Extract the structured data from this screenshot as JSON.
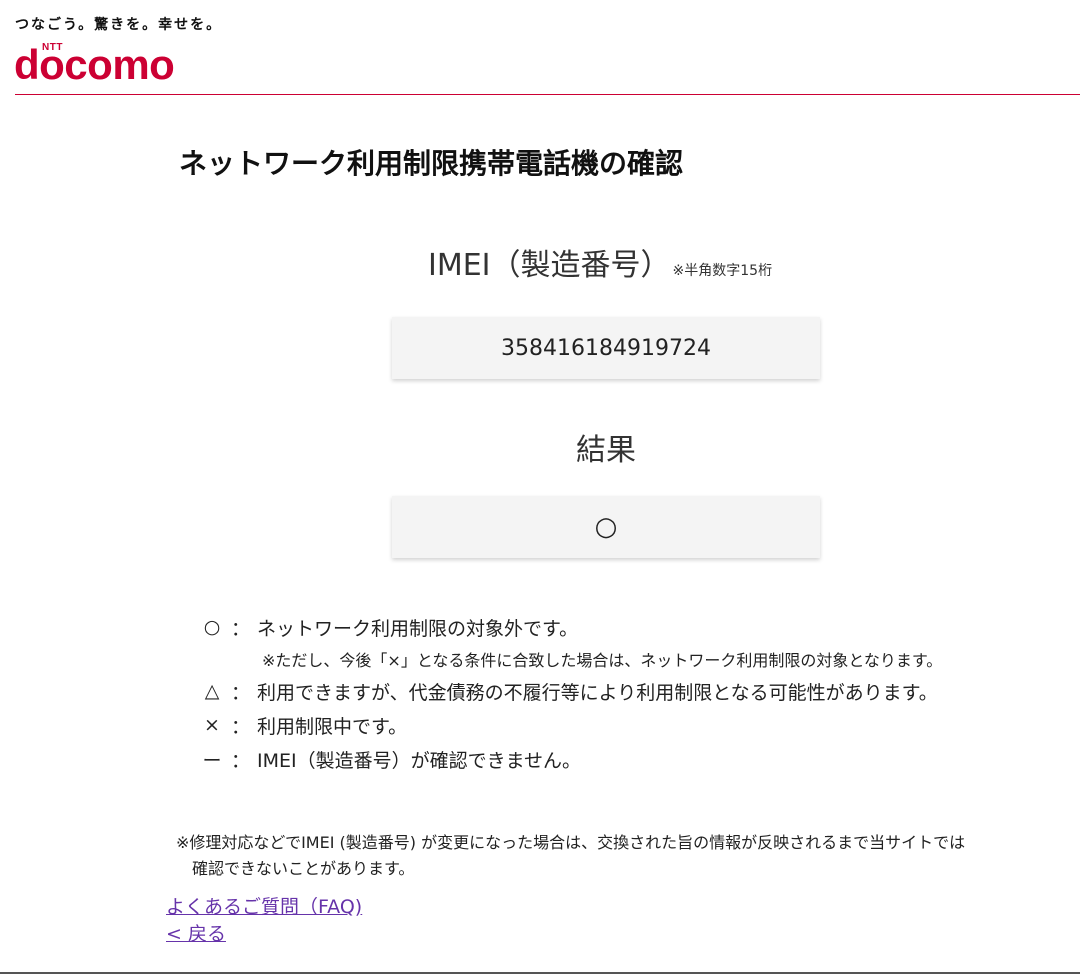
{
  "header": {
    "tagline": "つなごう。驚きを。幸せを。",
    "logo_small": "NTT",
    "logo_text": "docomo"
  },
  "page": {
    "title": "ネットワーク利用制限携帯電話機の確認"
  },
  "imei": {
    "label": "IMEI（製造番号）",
    "note": "※半角数字15桁",
    "value": "358416184919724"
  },
  "result": {
    "label": "結果",
    "value": "○"
  },
  "legend": {
    "items": [
      {
        "symbol": "○",
        "colon": "：",
        "text": "ネットワーク利用制限の対象外です。"
      },
      {
        "symbol": "△",
        "colon": "：",
        "text": "利用できますが、代金債務の不履行等により利用制限となる可能性があります。"
      },
      {
        "symbol": "×",
        "colon": "：",
        "text": "利用制限中です。"
      },
      {
        "symbol": "ー",
        "colon": "：",
        "text": "IMEI（製造番号）が確認できません。"
      }
    ],
    "note": "※ただし、今後「×」となる条件に合致した場合は、ネットワーク利用制限の対象となります。"
  },
  "footnote": {
    "line1": "※修理対応などでIMEI (製造番号) が変更になった場合は、交換された旨の情報が反映されるまで当サイトでは",
    "line2": "確認できないことがあります。"
  },
  "links": {
    "faq": "よくあるご質問（FAQ)",
    "back": "< 戻る"
  },
  "colors": {
    "brand": "#cc0033",
    "link": "#6633aa"
  }
}
